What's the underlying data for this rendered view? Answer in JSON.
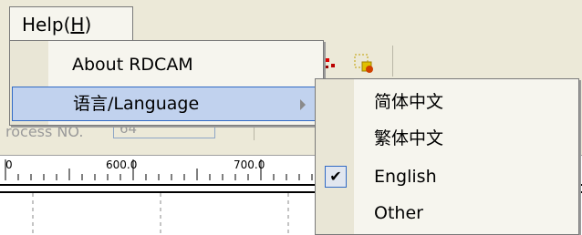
{
  "menubar": {
    "help_label_prefix": "Help(",
    "help_label_hotkey": "H",
    "help_label_suffix": ")"
  },
  "help_menu": {
    "items": [
      {
        "label": "About RDCAM"
      },
      {
        "label": "语言/Language",
        "has_submenu": true
      }
    ]
  },
  "language_submenu": {
    "items": [
      {
        "label": "简体中文",
        "checked": false
      },
      {
        "label": "繁体中文",
        "checked": false
      },
      {
        "label": "English",
        "checked": true,
        "check_glyph": "✔"
      },
      {
        "label": "Other",
        "checked": false
      }
    ]
  },
  "background": {
    "process_label": "rocess NO.",
    "process_value": "64",
    "ruler_marks": [
      "0",
      "600.0",
      "700.0"
    ]
  },
  "icons": {
    "toolbar_icons": [
      "toolbar-tool-icon",
      "toolbar-tool-icon"
    ],
    "submenu_arrow": "chevron-right-icon",
    "check": "checkmark-icon"
  }
}
